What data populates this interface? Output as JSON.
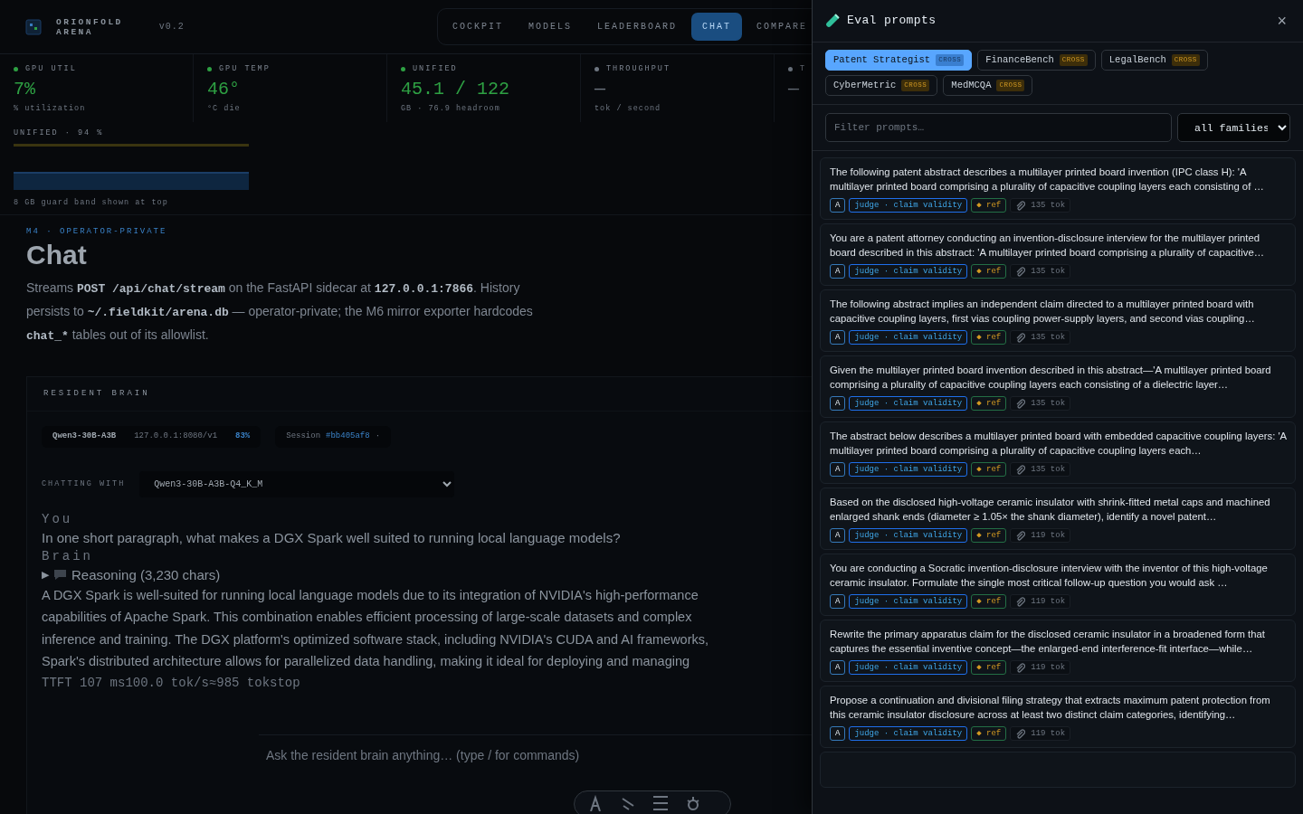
{
  "app": {
    "brand": [
      "ORIONFOLD",
      "ARENA"
    ],
    "version": "v0.2",
    "nav": [
      {
        "label": "COCKPIT",
        "selected": false
      },
      {
        "label": "MODELS",
        "selected": false
      },
      {
        "label": "LEADERBOARD",
        "selected": false
      },
      {
        "label": "CHAT",
        "selected": true
      },
      {
        "label": "COMPARE",
        "selected": false
      }
    ],
    "stats": [
      {
        "label": "GPU UTIL",
        "value": "7%",
        "caption": "% utilization",
        "color": "#2ea043"
      },
      {
        "label": "GPU TEMP",
        "value": "46°",
        "caption": "°C die",
        "color": "#2ea043"
      },
      {
        "label": "UNIFIED",
        "value": "45.1 / 122",
        "caption": "GB · 76.9 headroom",
        "color": "#2ea043"
      },
      {
        "label": "THROUGHPUT",
        "value": "—",
        "caption": "tok / second",
        "color": "#6e7681"
      },
      {
        "label": "T",
        "value": "—",
        "color": "#6e7681"
      }
    ],
    "memory": {
      "label": "UNIFIED · 94 %",
      "caption": "8 GB guard band shown at top"
    },
    "eyebrow": "M4 · OPERATOR-PRIVATE",
    "title": "Chat",
    "intro": [
      {
        "kind": "text",
        "text": "Streams "
      },
      {
        "kind": "code",
        "text": "POST /api/chat/stream"
      },
      {
        "kind": "text",
        "text": " on the FastAPI sidecar at "
      },
      {
        "kind": "code",
        "text": "127.0.0.1:7866"
      },
      {
        "kind": "text",
        "text": ". History persists to "
      },
      {
        "kind": "code",
        "text": "~/.fieldkit/arena.db"
      },
      {
        "kind": "text",
        "text": " — operator-private; the M6 mirror exporter hardcodes "
      },
      {
        "kind": "code",
        "text": "chat_*"
      },
      {
        "kind": "text",
        "text": " tables out of its allowlist."
      }
    ],
    "brain": {
      "title": "RESIDENT BRAIN",
      "model": "Qwen3-30B-A3B",
      "endpoint": "127.0.0.1:8080/v1",
      "load": "83%",
      "session_label": "Session",
      "session_id": "#bb405af8",
      "session_mark": "·"
    },
    "chatting_label": "CHATTING WITH",
    "model_select": "Qwen3-30B-A3B-Q4_K_M",
    "user": {
      "label": "You",
      "text": "In one short paragraph, what makes a DGX Spark well suited to running local language models?"
    },
    "reply": {
      "label": "Brain",
      "reasoning": {
        "arrow": "▶",
        "label": "Reasoning (3,230 chars)",
        "expanded": false
      },
      "lines": [
        "A DGX Spark is well-suited for running local language models due to its integration of NVIDIA's high-performance",
        "capabilities of Apache Spark. This combination enables efficient processing of large-scale datasets and complex",
        "inference and training. The DGX platform's optimized software stack, including NVIDIA's CUDA and AI frameworks,",
        "Spark's distributed architecture allows for parallelized data handling, making it ideal for deploying and managing"
      ],
      "stats": "TTFT 107 ms100.0 tok/s≈985 tokstop"
    },
    "composer": {
      "placeholder": "Ask the resident brain anything… (type / for commands)"
    }
  },
  "panel": {
    "title": "Eval prompts",
    "close": "×",
    "families": [
      {
        "label": "Patent Strategist",
        "badge": "CROSS",
        "selected": true
      },
      {
        "label": "FinanceBench",
        "badge": "CROSS",
        "selected": false
      },
      {
        "label": "LegalBench",
        "badge": "CROSS",
        "selected": false
      },
      {
        "label": "CyberMetric",
        "badge": "CROSS",
        "selected": false
      },
      {
        "label": "MedMCQA",
        "badge": "CROSS",
        "selected": false
      }
    ],
    "filter": {
      "placeholder": "Filter prompts…"
    },
    "family_select": "all families",
    "prompts": [
      {
        "text": "The following patent abstract describes a multilayer printed board invention (IPC class H): 'A multilayer printed board comprising a plurality of capacitive coupling layers each consisting of …",
        "grade": "A",
        "judge": "judge · claim validity",
        "ref": "◆ ref",
        "tokens": "135 tok"
      },
      {
        "text": "You are a patent attorney conducting an invention-disclosure interview for the multilayer printed board described in this abstract: 'A multilayer printed board comprising a plurality of capacitive…",
        "grade": "A",
        "judge": "judge · claim validity",
        "ref": "◆ ref",
        "tokens": "135 tok"
      },
      {
        "text": "The following abstract implies an independent claim directed to a multilayer printed board with capacitive coupling layers, first vias coupling power-supply layers, and second vias coupling…",
        "grade": "A",
        "judge": "judge · claim validity",
        "ref": "◆ ref",
        "tokens": "135 tok"
      },
      {
        "text": "Given the multilayer printed board invention described in this abstract—'A multilayer printed board comprising a plurality of capacitive coupling layers each consisting of a dielectric layer…",
        "grade": "A",
        "judge": "judge · claim validity",
        "ref": "◆ ref",
        "tokens": "135 tok"
      },
      {
        "text": "The abstract below describes a multilayer printed board with embedded capacitive coupling layers: 'A multilayer printed board comprising a plurality of capacitive coupling layers each…",
        "grade": "A",
        "judge": "judge · claim validity",
        "ref": "◆ ref",
        "tokens": "135 tok"
      },
      {
        "text": "Based on the disclosed high-voltage ceramic insulator with shrink-fitted metal caps and machined enlarged shank ends (diameter ≥ 1.05× the shank diameter), identify a novel patent…",
        "grade": "A",
        "judge": "judge · claim validity",
        "ref": "◆ ref",
        "tokens": "119 tok"
      },
      {
        "text": "You are conducting a Socratic invention-disclosure interview with the inventor of this high-voltage ceramic insulator. Formulate the single most critical follow-up question you would ask …",
        "grade": "A",
        "judge": "judge · claim validity",
        "ref": "◆ ref",
        "tokens": "119 tok"
      },
      {
        "text": "Rewrite the primary apparatus claim for the disclosed ceramic insulator in a broadened form that captures the essential inventive concept—the enlarged-end interference-fit interface—while…",
        "grade": "A",
        "judge": "judge · claim validity",
        "ref": "◆ ref",
        "tokens": "119 tok"
      },
      {
        "text": "Propose a continuation and divisional filing strategy that extracts maximum patent protection from this ceramic insulator disclosure across at least two distinct claim categories, identifying…",
        "grade": "A",
        "judge": "judge · claim validity",
        "ref": "◆ ref",
        "tokens": "119 tok"
      }
    ]
  }
}
